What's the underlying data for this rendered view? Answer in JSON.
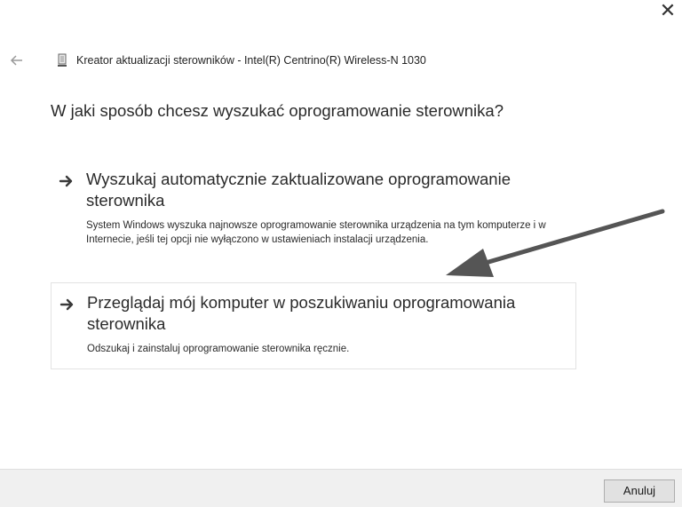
{
  "window": {
    "close_icon": "close-icon",
    "back_icon": "back-arrow-icon",
    "device_icon": "device-icon",
    "title": "Kreator aktualizacji sterowników - Intel(R) Centrino(R) Wireless-N 1030"
  },
  "main": {
    "heading": "W jaki sposób chcesz wyszukać oprogramowanie sterownika?",
    "options": [
      {
        "icon": "arrow-right-icon",
        "title": "Wyszukaj automatycznie zaktualizowane oprogramowanie sterownika",
        "description": "System Windows wyszuka najnowsze oprogramowanie sterownika urządzenia na tym komputerze i w Internecie, jeśli tej opcji nie wyłączono w ustawieniach instalacji urządzenia."
      },
      {
        "icon": "arrow-right-icon",
        "title": "Przeglądaj mój komputer w poszukiwaniu oprogramowania sterownika",
        "description": "Odszukaj i zainstaluj oprogramowanie sterownika ręcznie."
      }
    ]
  },
  "footer": {
    "cancel_label": "Anuluj"
  },
  "colors": {
    "background": "#ffffff",
    "footer_bg": "#f0f0f0",
    "annotation_arrow": "#555555"
  }
}
